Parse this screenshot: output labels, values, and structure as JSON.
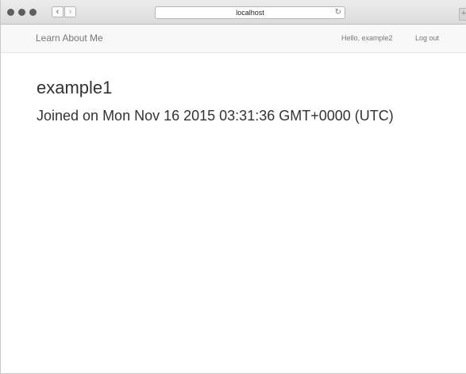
{
  "browser": {
    "url": "localhost",
    "back_glyph": "‹",
    "forward_glyph": "›",
    "reload_glyph": "↻",
    "newtab_glyph": "+"
  },
  "navbar": {
    "brand": "Learn About Me",
    "greeting": "Hello, example2",
    "logout": "Log out"
  },
  "profile": {
    "username": "example1",
    "joined": "Joined on Mon Nov 16 2015 03:31:36 GMT+0000 (UTC)"
  },
  "colors": {
    "traffic_lights": "#5e5e5e",
    "navbar_bg": "#f8f8f8",
    "navbar_text": "#777777",
    "heading_text": "#333333"
  }
}
